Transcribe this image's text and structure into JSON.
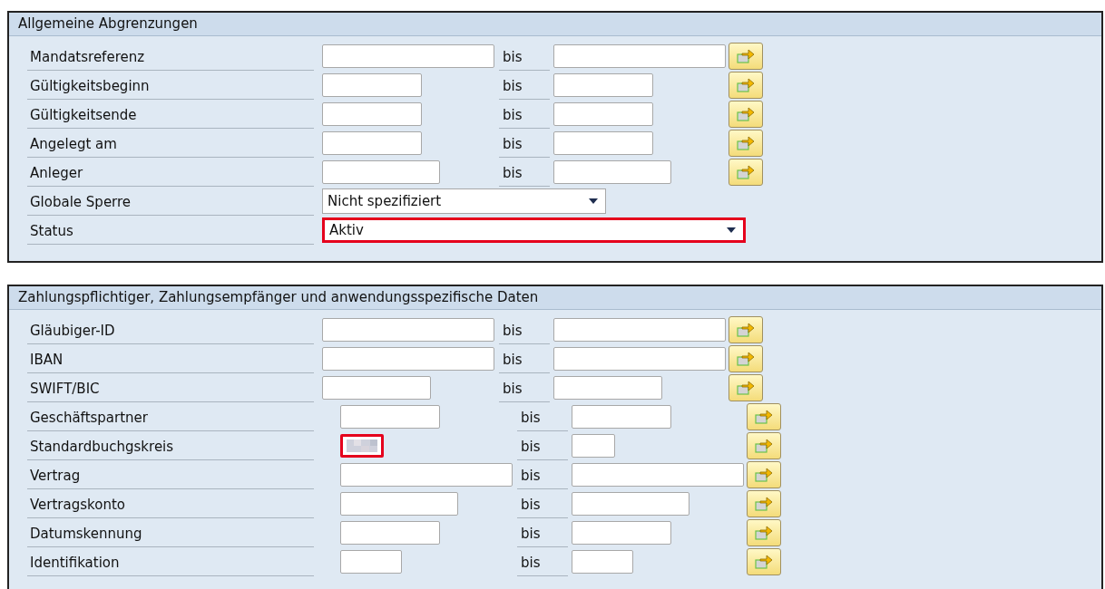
{
  "sections": [
    {
      "title": "Allgemeine Abgrenzungen",
      "rows": [
        {
          "kind": "range",
          "label": "Mandatsreferenz",
          "separator": "bis"
        },
        {
          "kind": "range",
          "label": "Gültigkeitsbeginn",
          "separator": "bis"
        },
        {
          "kind": "range",
          "label": "Gültigkeitsende",
          "separator": "bis"
        },
        {
          "kind": "range",
          "label": "Angelegt am",
          "separator": "bis"
        },
        {
          "kind": "range",
          "label": "Anleger",
          "separator": "bis"
        },
        {
          "kind": "dropdown",
          "label": "Globale Sperre",
          "value": "Nicht spezifiziert",
          "highlighted": false
        },
        {
          "kind": "dropdown",
          "label": "Status",
          "value": "Aktiv",
          "highlighted": true
        }
      ]
    },
    {
      "title": "Zahlungspflichtiger, Zahlungsempfänger und anwendungsspezifische Daten",
      "rows": [
        {
          "kind": "range",
          "label": "Gläubiger-ID",
          "separator": "bis"
        },
        {
          "kind": "range",
          "label": "IBAN",
          "separator": "bis"
        },
        {
          "kind": "range",
          "label": "SWIFT/BIC",
          "separator": "bis"
        },
        {
          "kind": "range",
          "label": "Geschäftspartner",
          "separator": "bis"
        },
        {
          "kind": "range",
          "label": "Standardbuchgskreis",
          "separator": "bis",
          "redacted": true,
          "highlighted": true
        },
        {
          "kind": "range",
          "label": "Vertrag",
          "separator": "bis"
        },
        {
          "kind": "range",
          "label": "Vertragskonto",
          "separator": "bis"
        },
        {
          "kind": "range",
          "label": "Datumskennung",
          "separator": "bis"
        },
        {
          "kind": "range",
          "label": "Identifikation",
          "separator": "bis"
        }
      ]
    }
  ]
}
